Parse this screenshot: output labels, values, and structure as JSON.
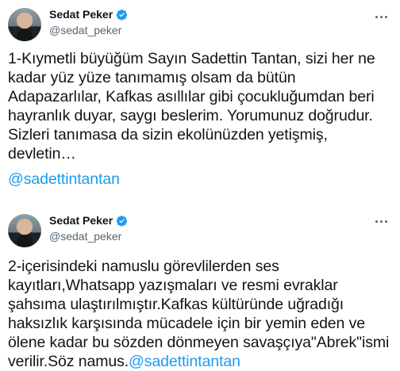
{
  "tweets": [
    {
      "display_name": "Sedat Peker",
      "handle": "@sedat_peker",
      "verified_icon": "verified-badge-icon",
      "more_icon": "more-horizontal-icon",
      "lines": [
        "1-Kıymetli büyüğüm Sayın Sadettin Tantan, sizi her ne",
        "kadar yüz yüze tanımamış olsam da bütün",
        "Adapazarlılar, Kafkas asıllılar gibi çocukluğumdan beri",
        "hayranlık duyar, saygı beslerim. Yorumunuz doğrudur.",
        "Sizleri tanımasa da sizin ekolünüzden yetişmiş,",
        "devletin…"
      ],
      "mention": "@sadettintantan"
    },
    {
      "display_name": "Sedat Peker",
      "handle": "@sedat_peker",
      "verified_icon": "verified-badge-icon",
      "more_icon": "more-horizontal-icon",
      "lines": [
        "2-içerisindeki namuslu görevlilerden ses",
        "kayıtları,Whatsapp yazışmaları ve resmi evraklar",
        "şahsıma ulaştırılmıştır.Kafkas kültüründe uğradığı",
        "haksızlık karşısında mücadele için bir yemin eden ve",
        "ölene kadar bu sözden dönmeyen savaşçıya\"Abrek\"ismi"
      ],
      "last_line_text": "verilir.Söz namus.",
      "mention": "@sadettintantan"
    }
  ],
  "colors": {
    "text": "#0f1419",
    "secondary": "#536471",
    "link": "#1d9bf0",
    "verified": "#1d9bf0"
  }
}
